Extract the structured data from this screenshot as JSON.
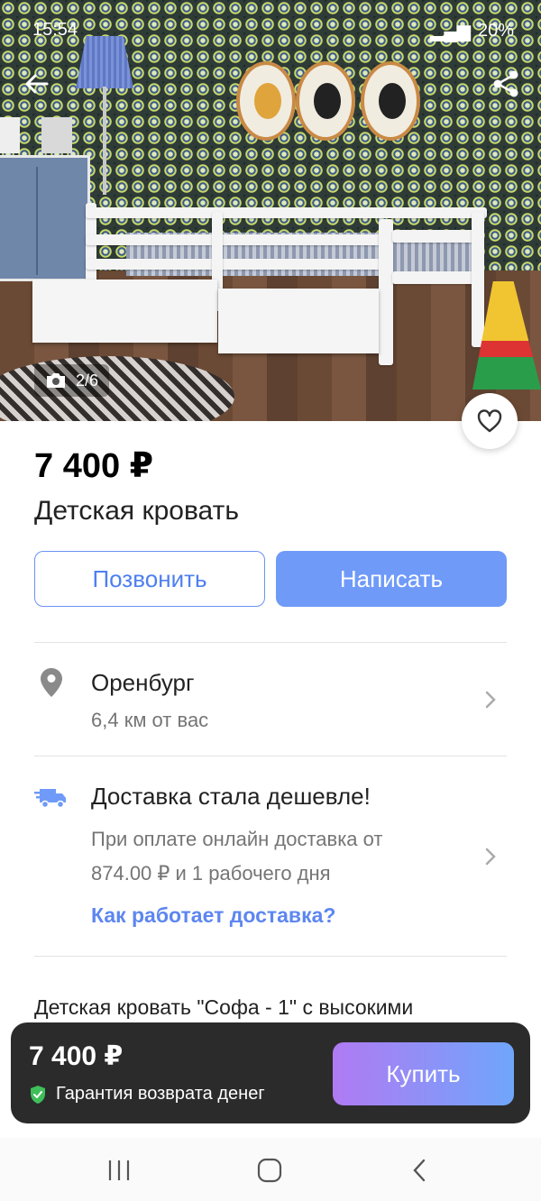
{
  "status_bar": {
    "time": "15:54",
    "battery": "20%"
  },
  "gallery": {
    "counter": "2/6"
  },
  "listing": {
    "price": "7 400 ₽",
    "title": "Детская кровать"
  },
  "actions": {
    "call_label": "Позвонить",
    "write_label": "Написать"
  },
  "location": {
    "city": "Оренбург",
    "distance": "6,4 км от вас"
  },
  "delivery": {
    "title": "Доставка стала дешевле!",
    "line1": "При оплате онлайн доставка от",
    "line2": "874.00 ₽ и 1 рабочего дня",
    "link": "Как работает доставка?"
  },
  "description": {
    "preview": "Детская кровать \"Софа - 1\" с высокими"
  },
  "buy_bar": {
    "price": "7 400 ₽",
    "guarantee": "Гарантия возврата денег",
    "buy_label": "Купить"
  },
  "colors": {
    "accent": "#6f9af8",
    "link": "#5d86f0",
    "guarantee_check": "#3fbf5a",
    "buy_gradient_start": "#b07af3",
    "buy_gradient_end": "#6fa6fb"
  },
  "icons": {
    "back": "arrow-left-icon",
    "share": "share-icon",
    "camera": "camera-icon",
    "favorite": "heart-icon",
    "location": "map-pin-icon",
    "delivery": "truck-icon",
    "chevron": "chevron-right-icon",
    "check": "check-shield-icon"
  }
}
